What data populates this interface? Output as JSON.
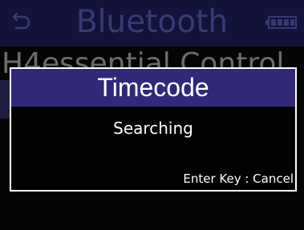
{
  "background": {
    "header_title": "Bluetooth",
    "back_icon": "return-arrow-icon",
    "battery_icon": "battery-icon",
    "list_item_label": "H4essential Control"
  },
  "dialog": {
    "title": "Timecode",
    "message": "Searching",
    "hint": "Enter Key : Cancel"
  },
  "colors": {
    "dialog_header": "#2f2977",
    "dimmed_header": "#12123a",
    "dialog_text": "#ffffff",
    "background": "#050508"
  }
}
